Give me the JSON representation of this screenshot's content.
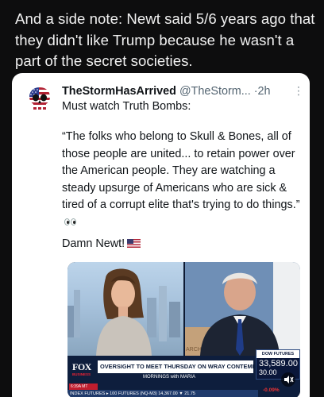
{
  "intro_text": "And a side note: Newt said 5/6 years ago that they didn't like Trump because he wasn't a part of the secret societies.",
  "post": {
    "author_name": "TheStormHasArrived",
    "author_handle": "@TheStorm...",
    "separator": "·",
    "time_ago": "2h",
    "first_line": "Must watch Truth Bombs:",
    "quote": "“The folks who belong to Skull & Bones, all of those people are united... to retain power over the American people. They are watching a steady upsurge of Americans who are sick & tired of a corrupt elite that's trying to do things.”",
    "closing": "Damn Newt!",
    "menu_icon": "more-vertical-icon",
    "emoji": [
      "eyes-icon",
      "us-flag-icon"
    ]
  },
  "video": {
    "network": "FOX",
    "network_sub": "BUSINESS",
    "clock": "6:39A MT",
    "headline": "OVERSIGHT TO MEET THURSDAY ON WRAY CONTEMPT CHARGE",
    "show": "MORNINGS with MARIA",
    "ticker": "INDEX FUTURES  ▸ 100 FUTURES (NQ-M3)  14,367.00  ▼ 21.75",
    "background_sign": "ARCH",
    "dow_label": "DOW FUTURES",
    "dow_value": "33,589.00",
    "dow_change": "30.00",
    "dow_pct": "-0.09%",
    "speaker_icon": "volume-icon",
    "colors": {
      "chyron_navy": "#0e1e3d",
      "fox_red": "#c01d2e",
      "down_red": "#e33333"
    }
  }
}
